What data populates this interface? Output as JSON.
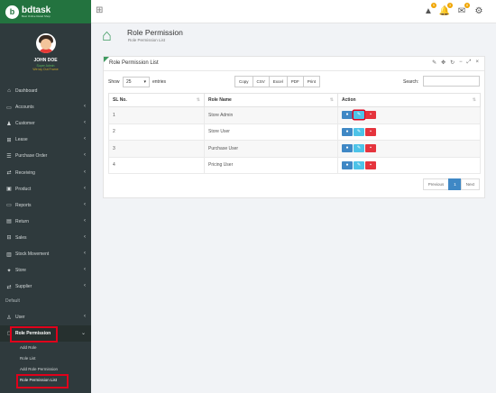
{
  "brand": {
    "name": "bdtask",
    "tagline": "Best Online Retail Shop"
  },
  "user": {
    "name": "JOHN DOE",
    "status": "Super Admin",
    "status2": "We lay Out Frame"
  },
  "sidebar": {
    "items": [
      {
        "label": "Dashboard",
        "icon": "home-icon",
        "glyph": "⌂"
      },
      {
        "label": "Accounts",
        "icon": "folder-icon",
        "glyph": "▭"
      },
      {
        "label": "Customer",
        "icon": "user-icon",
        "glyph": "♟"
      },
      {
        "label": "Lease",
        "icon": "cart-icon",
        "glyph": "⊞"
      },
      {
        "label": "Purchase Order",
        "icon": "list-icon",
        "glyph": "☰"
      },
      {
        "label": "Receiving",
        "icon": "handshake-icon",
        "glyph": "⇄"
      },
      {
        "label": "Product",
        "icon": "bag-icon",
        "glyph": "▣"
      },
      {
        "label": "Reports",
        "icon": "report-icon",
        "glyph": "▭"
      },
      {
        "label": "Return",
        "icon": "return-icon",
        "glyph": "▤"
      },
      {
        "label": "Sales",
        "icon": "sales-icon",
        "glyph": "⊟"
      },
      {
        "label": "Stock Movement",
        "icon": "stock-icon",
        "glyph": "▥"
      },
      {
        "label": "Store",
        "icon": "store-icon",
        "glyph": "✦"
      },
      {
        "label": "Supplier",
        "icon": "supplier-icon",
        "glyph": "⇄"
      }
    ],
    "section": "Default",
    "user_item": {
      "label": "User",
      "icon": "user-icon",
      "glyph": "♙"
    },
    "role_item": {
      "label": "Role Permission",
      "icon": "lock-icon",
      "glyph": "🔒"
    },
    "sub_items": [
      "Add Role",
      "Role List",
      "Add Role Permission",
      "Role Permission List"
    ]
  },
  "header": {
    "title": "Role Permission",
    "subtitle": "Role Permission List",
    "badges": [
      "5",
      "3",
      "8"
    ]
  },
  "panel": {
    "title": "Role Permission List",
    "show_label": "Show",
    "entries_value": "25",
    "entries_label": "entries",
    "export_buttons": [
      "Copy",
      "CSV",
      "Excel",
      "PDF",
      "Print"
    ],
    "search_label": "Search:",
    "columns": [
      "SL No.",
      "Role Name",
      "Action"
    ],
    "rows": [
      {
        "sl": "1",
        "role": "Store Admin"
      },
      {
        "sl": "2",
        "role": "Store User"
      },
      {
        "sl": "3",
        "role": "Purchase User"
      },
      {
        "sl": "4",
        "role": "Pricing User"
      }
    ],
    "pager": {
      "prev": "Previous",
      "current": "1",
      "next": "Next"
    }
  },
  "colors": {
    "accent": "#3f9a61",
    "view": "#3f88c5",
    "edit": "#4dc3e8",
    "delete": "#e5343d",
    "highlight": "#e0001b"
  }
}
